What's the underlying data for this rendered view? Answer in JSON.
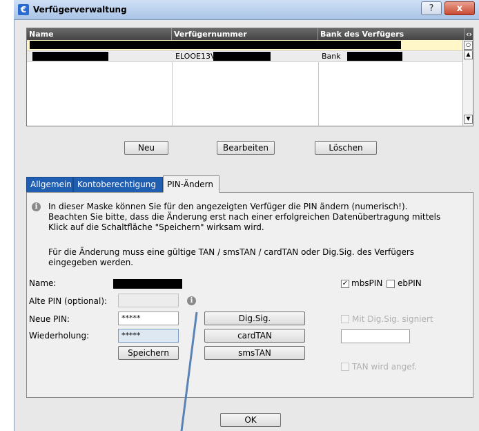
{
  "window": {
    "title": "Verfügerverwaltung",
    "help_symbol": "?",
    "close_symbol": "x"
  },
  "list": {
    "columns": [
      "Name",
      "Verfügernummer",
      "Bank des Verfügers"
    ],
    "rows": [
      {
        "name": "",
        "number": "",
        "bank": ""
      },
      {
        "name": "",
        "number": "ELOOE13V",
        "bank": "Bank"
      }
    ]
  },
  "buttons": {
    "new": "Neu",
    "edit": "Bearbeiten",
    "delete": "Löschen",
    "ok": "OK"
  },
  "tabs": [
    "Allgemein",
    "Kontoberechtigung",
    "PIN-Ändern"
  ],
  "pin": {
    "info_text": "In dieser Maske können Sie für den angezeigten Verfüger die PIN ändern (numerisch!). Beachten Sie bitte, dass die Änderung erst nach einer erfolgreichen Datenübertragung mittels Klick auf die Schaltfläche \"Speichern\" wirksam wird.",
    "info_line1": "In dieser Maske können Sie für den angezeigten Verfüger die PIN ändern (numerisch!).",
    "info_line2": "Beachten Sie bitte, dass die Änderung erst nach einer erfolgreichen Datenübertragung mittels",
    "info_line3": "Klick auf die Schaltfläche \"Speichern\" wirksam wird.",
    "note_line1": "Für die Änderung muss eine gültige TAN / smsTAN / cardTAN oder Dig.Sig. des Verfügers",
    "note_line2": "eingegeben werden.",
    "name_label": "Name:",
    "old_pin_label": "Alte PIN (optional):",
    "new_pin_label": "Neue PIN:",
    "repeat_label": "Wiederholung:",
    "new_pin_value": "*****",
    "repeat_value": "*****",
    "save_button": "Speichern",
    "digsig_button": "Dig.Sig.",
    "cardtan_button": "cardTAN",
    "smstan_button": "smsTAN",
    "mbspin_label": "mbsPIN",
    "ebpin_label": "ebPIN",
    "mbspin_checked": true,
    "ebpin_checked": false,
    "signed_label": "Mit Dig.Sig. signiert",
    "tan_requested_label": "TAN wird angef."
  }
}
